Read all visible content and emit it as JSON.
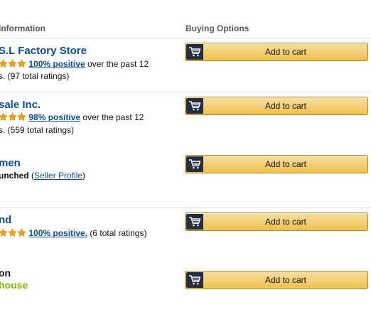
{
  "headers": {
    "seller_info": "Information",
    "buying_options": "Buying Options"
  },
  "colors": {
    "link": "#0f4c8a",
    "star": "#f0a10e",
    "button_top": "#f7dfa5",
    "button_bottom": "#f0c14b",
    "warehouse_green": "#7fba00"
  },
  "sellers": [
    {
      "name": "S.L Factory Store",
      "rating_stars": 3,
      "positive_text": "100% positive",
      "over_text": "over the past 12",
      "line2": "s. (97 total ratings)",
      "button_label": "Add to cart",
      "button_icon": "cart-icon"
    },
    {
      "name": "sale Inc.",
      "rating_stars": 3,
      "positive_text": "98% positive",
      "over_text": "over the past 12",
      "line2": "s. (559 total ratings)",
      "button_label": "Add to cart",
      "button_icon": "cart-icon"
    },
    {
      "name": "men",
      "launched_text": "unched",
      "paren_open": "(",
      "seller_profile_link": "Seller Profile",
      "paren_close": ")",
      "button_label": "Add to cart",
      "button_icon": "cart-icon"
    },
    {
      "name": "nd",
      "rating_stars": 3,
      "positive_text": "100% positive.",
      "ratings_text": "(6 total ratings)",
      "button_label": "Add to cart",
      "button_icon": "cart-icon"
    },
    {
      "logo_line1": "on",
      "logo_line2": "house",
      "button_label": "Add to cart",
      "button_icon": "cart-icon"
    }
  ]
}
